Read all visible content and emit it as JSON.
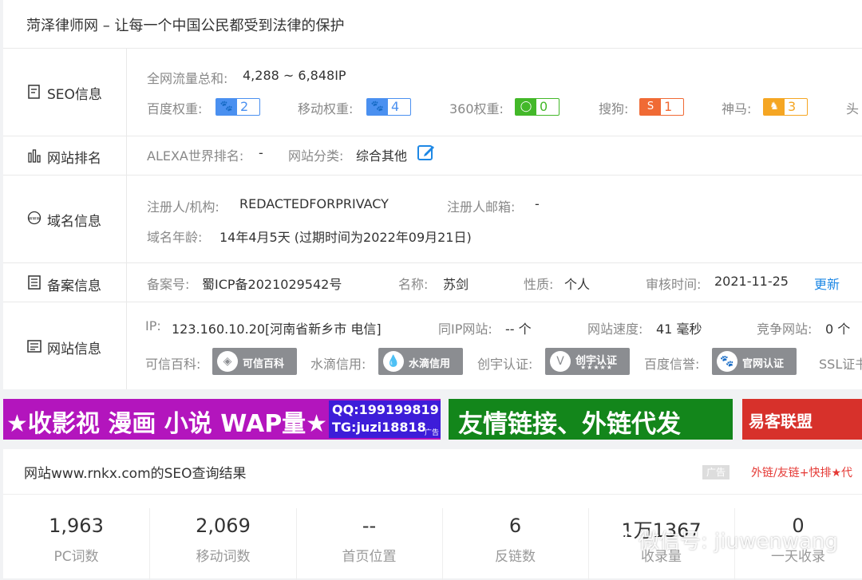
{
  "page_title": "菏泽律师网 – 让每一个中国公民都受到法律的保护",
  "seo": {
    "label": "SEO信息",
    "traffic_key": "全网流量总和:",
    "traffic_value": "4,288 ~ 6,848IP",
    "baidu": {
      "key": "百度权重:",
      "value": "2",
      "color": "#4a90f0"
    },
    "mobile": {
      "key": "移动权重:",
      "value": "4",
      "color": "#4a90f0"
    },
    "so360": {
      "key": "360权重:",
      "value": "0",
      "color": "#43b829"
    },
    "sogou": {
      "key": "搜狗:",
      "value": "1",
      "color": "#f06a35"
    },
    "shenma": {
      "key": "神马:",
      "value": "3",
      "color": "#f5a623"
    },
    "toutiao_key": "头"
  },
  "rank": {
    "label": "网站排名",
    "alexa_key": "ALEXA世界排名:",
    "alexa_value": "-",
    "category_key": "网站分类:",
    "category_value": "综合其他"
  },
  "domain": {
    "label": "域名信息",
    "registrant_key": "注册人/机构:",
    "registrant_value": "REDACTEDFORPRIVACY",
    "email_key": "注册人邮箱:",
    "email_value": "-",
    "age_key": "域名年龄:",
    "age_value": "14年4月5天 (过期时间为2022年09月21日)"
  },
  "icp": {
    "label": "备案信息",
    "no_key": "备案号:",
    "no_value": "蜀ICP备2021029542号",
    "name_key": "名称:",
    "name_value": "苏剑",
    "nature_key": "性质:",
    "nature_value": "个人",
    "date_key": "审核时间:",
    "date_value": "2021-11-25",
    "update": "更新"
  },
  "site": {
    "label": "网站信息",
    "ip_key": "IP:",
    "ip_value": "123.160.10.20[河南省新乡市 电信]",
    "same_ip_key": "同IP网站:",
    "same_ip_value": "-- 个",
    "speed_key": "网站速度:",
    "speed_value": "41 毫秒",
    "compete_key": "竞争网站:",
    "compete_value": "0 个",
    "kexin_key": "可信百科:",
    "kexin_badge": "可信百科",
    "shuidi_key": "水滴信用:",
    "shuidi_badge": "水滴信用",
    "chuangyu_key": "创宇认证:",
    "chuangyu_badge": "创宇认证",
    "baidu_credit_key": "百度信誉:",
    "baidu_credit_badge": "官网认证",
    "ssl_key": "SSL证书"
  },
  "banners": {
    "b1_text": "★收影视 漫画 小说 WAP量★",
    "b1_qq": "QQ:199199819",
    "b1_tg": "TG:juzi18818",
    "b1_ad": "广告",
    "b2_text": "友情链接、外链代发",
    "b3_text": "易客联盟"
  },
  "result": {
    "title": "网站www.rnkx.com的SEO查询结果",
    "ad_tag": "广告",
    "ad_link": "外链/友链+快排★代",
    "stats": [
      {
        "value": "1,963",
        "label": "PC词数"
      },
      {
        "value": "2,069",
        "label": "移动词数"
      },
      {
        "value": "--",
        "label": "首页位置"
      },
      {
        "value": "6",
        "label": "反链数"
      },
      {
        "value": "1万1367",
        "label": "收录量"
      },
      {
        "value": "0",
        "label": "一天收录"
      }
    ]
  },
  "watermark": "微信号: jiuwenwang"
}
